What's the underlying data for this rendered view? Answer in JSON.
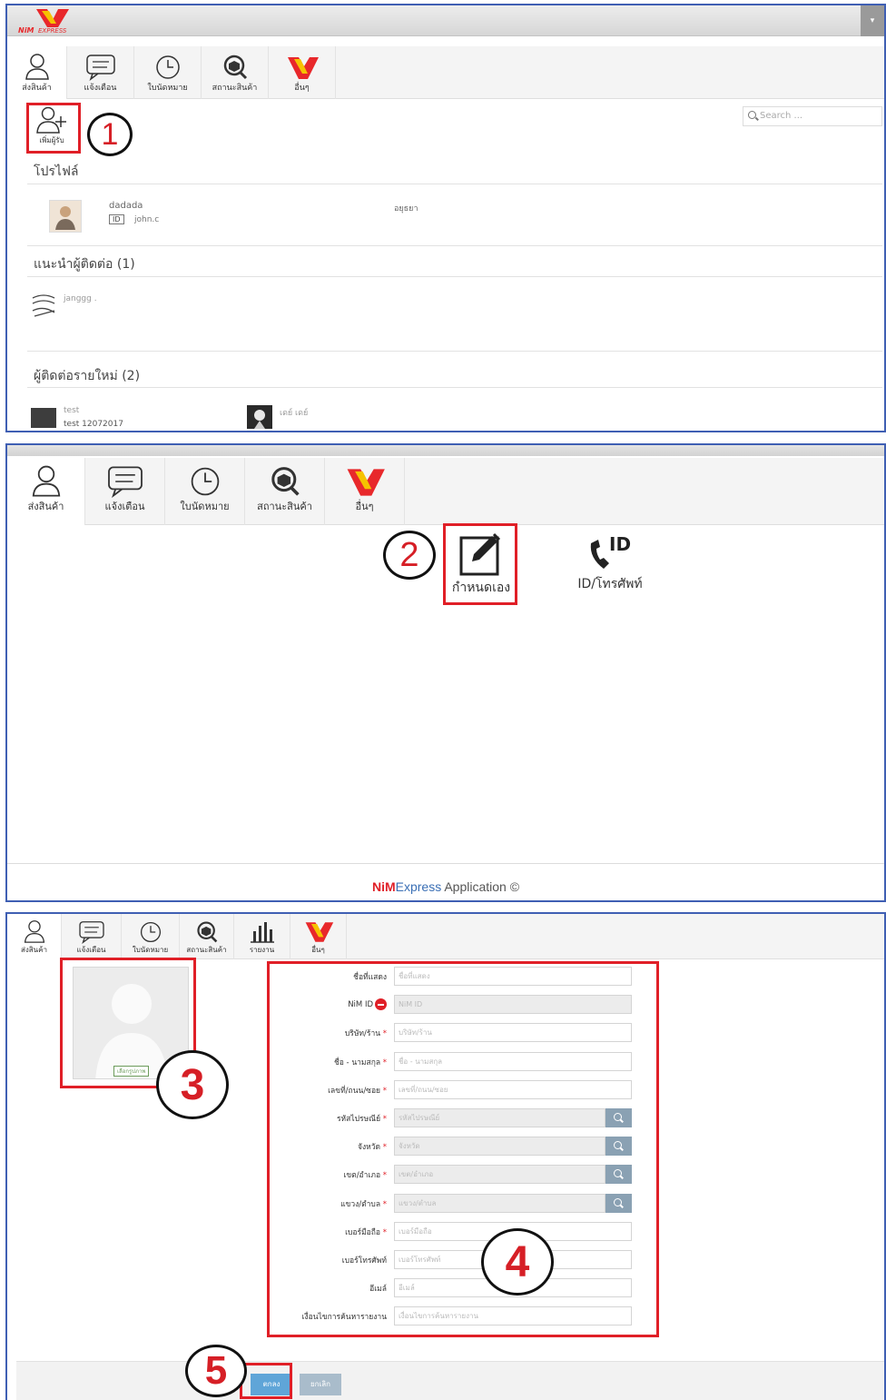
{
  "panel1": {
    "logo_text": "NiM EXPRESS",
    "tabs": [
      {
        "label": "ส่งสินค้า",
        "icon": "user-icon"
      },
      {
        "label": "แจ้งเตือน",
        "icon": "message-icon"
      },
      {
        "label": "ใบนัดหมาย",
        "icon": "clock-icon"
      },
      {
        "label": "สถานะสินค้า",
        "icon": "box-search-icon"
      },
      {
        "label": "อื่นๆ",
        "icon": "nim-logo-icon"
      }
    ],
    "add_receiver_label": "เพิ่มผู้รับ",
    "step1": "1",
    "search_placeholder": "Search ...",
    "profile_title": "โปรไฟล์",
    "profile_name": "dadada",
    "profile_id_badge": "ID",
    "profile_id": "john.c",
    "profile_location": "อยุธยา",
    "suggest_title": "แนะนำผู้ติดต่อ (1)",
    "suggest_name": "janggg .",
    "new_contacts_title": "ผู้ติดต่อรายใหม่ (2)",
    "new_contacts": [
      {
        "name": "test",
        "sub": "test 12072017"
      },
      {
        "name": "เดย์ เดย์",
        "sub": ""
      }
    ]
  },
  "panel2": {
    "tabs": [
      {
        "label": "ส่งสินค้า",
        "icon": "user-icon"
      },
      {
        "label": "แจ้งเตือน",
        "icon": "message-icon"
      },
      {
        "label": "ใบนัดหมาย",
        "icon": "clock-icon"
      },
      {
        "label": "สถานะสินค้า",
        "icon": "box-search-icon"
      },
      {
        "label": "อื่นๆ",
        "icon": "nim-logo-icon"
      }
    ],
    "step2": "2",
    "option_custom": "กำหนดเอง",
    "option_id_phone": "ID/โทรศัพท์",
    "id_mark": "ID",
    "footer_brand_nim": "NiM",
    "footer_brand_express": "Express",
    "footer_suffix": " Application ©"
  },
  "panel3": {
    "tabs": [
      {
        "label": "ส่งสินค้า",
        "icon": "user-icon"
      },
      {
        "label": "แจ้งเตือน",
        "icon": "message-icon"
      },
      {
        "label": "ใบนัดหมาย",
        "icon": "clock-icon"
      },
      {
        "label": "สถานะสินค้า",
        "icon": "box-search-icon"
      },
      {
        "label": "รายงาน",
        "icon": "bar-chart-icon"
      },
      {
        "label": "อื่นๆ",
        "icon": "nim-logo-icon"
      }
    ],
    "choose_image": "เลือกรูปภาพ",
    "step3": "3",
    "step4": "4",
    "step5": "5",
    "form": [
      {
        "label": "ชื่อที่แสดง",
        "required": false,
        "placeholder": "ชื่อที่แสดง",
        "type": "text"
      },
      {
        "label": "NiM ID",
        "required": false,
        "placeholder": "NiM ID",
        "type": "disabled"
      },
      {
        "label": "บริษัท/ร้าน",
        "required": true,
        "placeholder": "บริษัท/ร้าน",
        "type": "text"
      },
      {
        "label": "ชื่อ - นามสกุล",
        "required": true,
        "placeholder": "ชื่อ - นามสกุล",
        "type": "text"
      },
      {
        "label": "เลขที่/ถนน/ซอย",
        "required": true,
        "placeholder": "เลขที่/ถนน/ซอย",
        "type": "text"
      },
      {
        "label": "รหัสไปรษณีย์",
        "required": true,
        "placeholder": "รหัสไปรษณีย์",
        "type": "search"
      },
      {
        "label": "จังหวัด",
        "required": true,
        "placeholder": "จังหวัด",
        "type": "search"
      },
      {
        "label": "เขต/อำเภอ",
        "required": true,
        "placeholder": "เขต/อำเภอ",
        "type": "search"
      },
      {
        "label": "แขวง/ตำบล",
        "required": true,
        "placeholder": "แขวง/ตำบล",
        "type": "search"
      },
      {
        "label": "เบอร์มือถือ",
        "required": true,
        "placeholder": "เบอร์มือถือ",
        "type": "text"
      },
      {
        "label": "เบอร์โทรศัพท์",
        "required": false,
        "placeholder": "เบอร์โทรศัพท์",
        "type": "text"
      },
      {
        "label": "อีเมล์",
        "required": false,
        "placeholder": "อีเมล์",
        "type": "text"
      },
      {
        "label": "เงื่อนไขการค้นหารายงาน",
        "required": false,
        "placeholder": "เงื่อนไขการค้นหารายงาน",
        "type": "text"
      }
    ],
    "ok_label": "ตกลง",
    "cancel_label": "ยกเลิก"
  },
  "colors": {
    "accent_red": "#e01f27",
    "frame_blue": "#3f5fb3",
    "ok_blue": "#5fa5d8"
  }
}
